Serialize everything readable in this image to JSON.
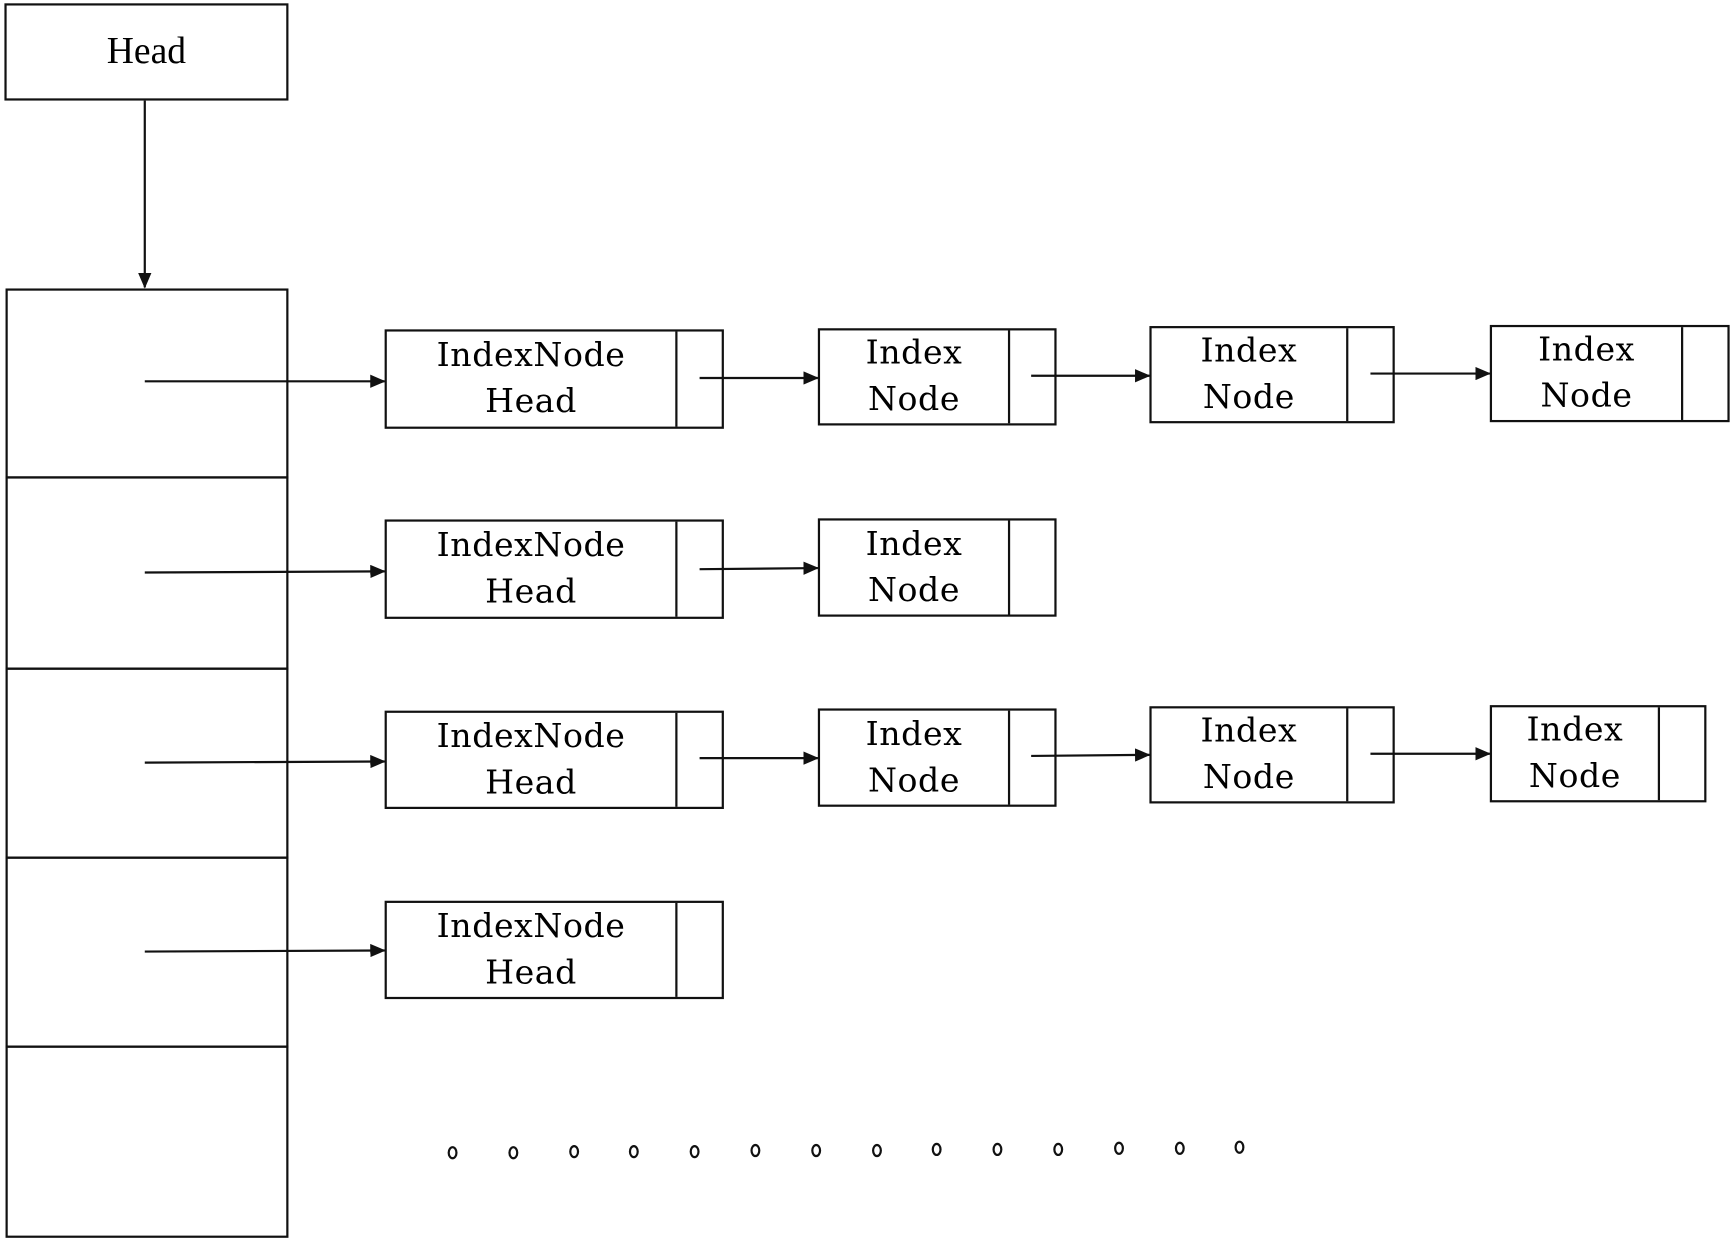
{
  "diagram": {
    "head": {
      "label": "Head"
    },
    "buckets": [
      {
        "nodes": [
          {
            "line1": "IndexNode",
            "line2": "Head"
          },
          {
            "line1": "Index",
            "line2": "Node"
          },
          {
            "line1": "Index",
            "line2": "Node"
          },
          {
            "line1": "Index",
            "line2": "Node"
          }
        ]
      },
      {
        "nodes": [
          {
            "line1": "IndexNode",
            "line2": "Head"
          },
          {
            "line1": "Index",
            "line2": "Node"
          }
        ]
      },
      {
        "nodes": [
          {
            "line1": "IndexNode",
            "line2": "Head"
          },
          {
            "line1": "Index",
            "line2": "Node"
          },
          {
            "line1": "Index",
            "line2": "Node"
          },
          {
            "line1": "Index",
            "line2": "Node"
          }
        ]
      },
      {
        "nodes": [
          {
            "line1": "IndexNode",
            "line2": "Head"
          }
        ]
      },
      {
        "nodes": []
      }
    ],
    "continuation": {
      "symbol": "o",
      "count": 14
    }
  }
}
